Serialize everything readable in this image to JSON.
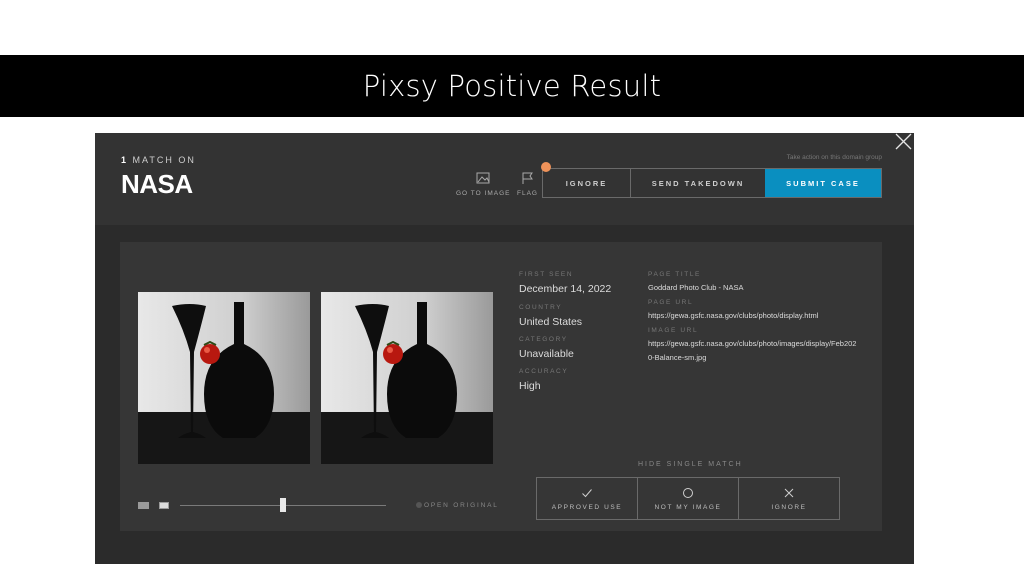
{
  "slide": {
    "title": "Pixsy Positive Result"
  },
  "header": {
    "match_count": "1",
    "match_label": "MATCH ON",
    "site_name": "NASA",
    "tools": {
      "go_to_image": "GO TO IMAGE",
      "flag": "FLAG"
    },
    "action_group_label": "Take action on this domain group",
    "actions": {
      "ignore": "IGNORE",
      "send_takedown": "SEND TAKEDOWN",
      "submit_case": "SUBMIT CASE"
    }
  },
  "details": {
    "first_seen_label": "FIRST SEEN",
    "first_seen": "December 14, 2022",
    "country_label": "COUNTRY",
    "country": "United States",
    "category_label": "CATEGORY",
    "category": "Unavailable",
    "accuracy_label": "ACCURACY",
    "accuracy": "High",
    "page_title_label": "PAGE TITLE",
    "page_title": "Goddard Photo Club - NASA",
    "page_url_label": "PAGE URL",
    "page_url": "https://gewa.gsfc.nasa.gov/clubs/photo/display.html",
    "image_url_label": "IMAGE URL",
    "image_url": "https://gewa.gsfc.nasa.gov/clubs/photo/images/display/Feb2020-Balance-sm.jpg"
  },
  "match_actions": {
    "hide_single_match": "HIDE SINGLE MATCH",
    "approved_use": "APPROVED USE",
    "not_my_image": "NOT MY IMAGE",
    "ignore": "IGNORE"
  },
  "viewer": {
    "open_original": "OPEN ORIGINAL",
    "compare_slider": 0.5
  },
  "colors": {
    "accent": "#0a8fc0",
    "notification": "#f0935a",
    "panel": "#2b2b2b"
  },
  "icons": [
    "image-icon",
    "flag-icon",
    "close-icon",
    "check-icon",
    "circle-icon",
    "x-icon"
  ]
}
